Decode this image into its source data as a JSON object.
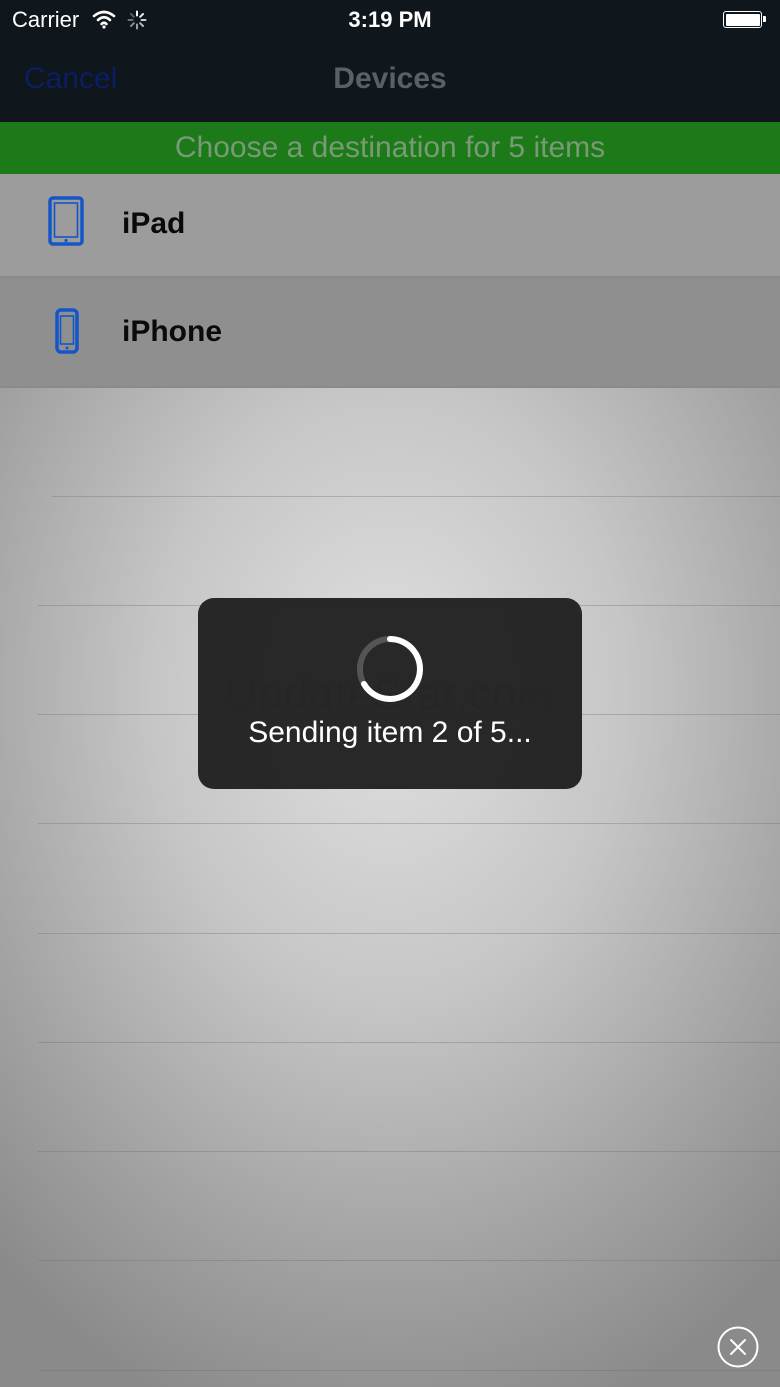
{
  "status_bar": {
    "carrier": "Carrier",
    "time": "3:19 PM",
    "icons": [
      "wifi-icon",
      "activity-spinner-icon",
      "battery-icon"
    ]
  },
  "nav": {
    "cancel_label": "Cancel",
    "title": "Devices"
  },
  "banner": {
    "text": "Choose a destination for 5 items"
  },
  "devices": [
    {
      "label": "iPad",
      "icon": "ipad-icon"
    },
    {
      "label": "iPhone",
      "icon": "iphone-icon"
    }
  ],
  "watermark": "UpdateStar.com",
  "hud": {
    "message": "Sending item 2 of 5..."
  },
  "close_icon": "close-circle-icon",
  "colors": {
    "bar": "#0f161c",
    "banner": "#1d7a18",
    "device_icon": "#1456c8",
    "hud": "#202020"
  }
}
